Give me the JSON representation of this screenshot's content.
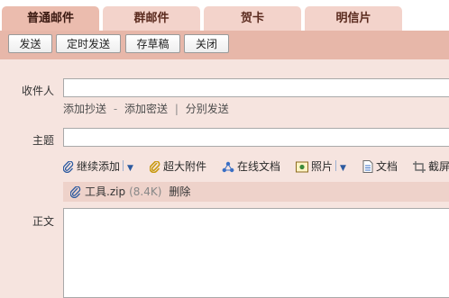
{
  "tabs": [
    {
      "label": "普通邮件",
      "active": true
    },
    {
      "label": "群邮件",
      "active": false
    },
    {
      "label": "贺卡",
      "active": false
    },
    {
      "label": "明信片",
      "active": false
    }
  ],
  "toolbar": {
    "send": "发送",
    "scheduled_send": "定时发送",
    "save_draft": "存草稿",
    "close": "关闭"
  },
  "form": {
    "to_label": "收件人",
    "to_value": "",
    "cc_link": "添加抄送",
    "dash": "-",
    "bcc_link": "添加密送",
    "pipe": "|",
    "separate_link": "分别发送",
    "subject_label": "主题",
    "subject_value": "",
    "body_label": "正文",
    "body_value": ""
  },
  "attach_bar": {
    "continue_add": "继续添加",
    "large_attach": "超大附件",
    "online_doc": "在线文档",
    "photo": "照片",
    "document": "文档",
    "screenshot": "截屏"
  },
  "attachment": {
    "name": "工具.zip",
    "size": "(8.4K)",
    "delete": "删除"
  },
  "icons": {
    "paperclip": "paperclip-icon",
    "large_clip": "large-attachment-icon",
    "online_doc": "online-doc-icon",
    "photo": "photo-icon",
    "document": "document-icon",
    "screenshot": "screenshot-icon",
    "dropdown": "dropdown-arrow-icon"
  },
  "colors": {
    "tab_active": "#ebbcae",
    "tab_inactive": "#f3d3cb",
    "toolbar": "#e7b7a9",
    "form_bg": "#f6e4df",
    "link_blue": "#2c5aa0"
  }
}
